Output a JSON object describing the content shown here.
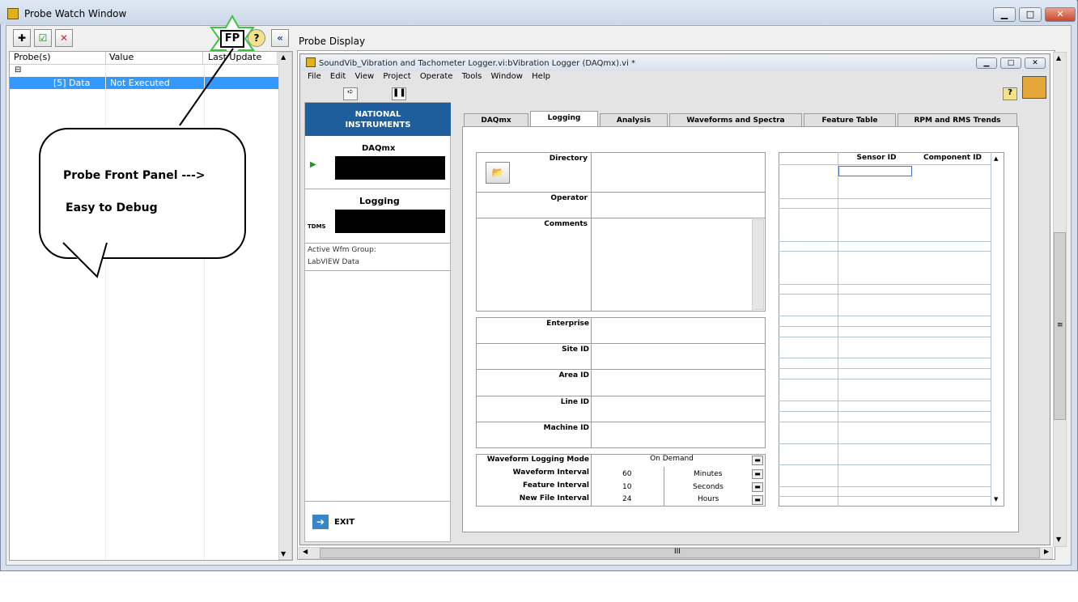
{
  "window": {
    "title": "Probe Watch Window",
    "min": "▁",
    "max": "□",
    "close": "✕"
  },
  "toolbar": {
    "new_probe": "✚",
    "manage": "☑",
    "delete": "✕",
    "fp": "FP",
    "help": "?",
    "collapse": "«"
  },
  "probe_list": {
    "headers": [
      "Probe(s)",
      "Value",
      "Last Update"
    ],
    "group_toggle": "⊟",
    "rows": [
      {
        "probe": "[5] Data",
        "value": "Not Executed"
      }
    ]
  },
  "display_label": "Probe Display",
  "vi": {
    "title": "SoundVib_Vibration and Tachometer Logger.vi:bVibration Logger (DAQmx).vi *",
    "menu": [
      "File",
      "Edit",
      "View",
      "Project",
      "Operate",
      "Tools",
      "Window",
      "Help"
    ],
    "left": {
      "logo": "NATIONAL\nINSTRUMENTS",
      "daqmx_label": "DAQmx",
      "logging_label": "Logging",
      "tdms": "TDMS",
      "group_label": "Active Wfm Group:",
      "group_value": "LabVIEW Data",
      "exit_label": "EXIT"
    },
    "tabs": [
      "DAQmx",
      "Logging",
      "Analysis",
      "Waveforms and Spectra",
      "Feature Table",
      "RPM and RMS Trends"
    ],
    "form": {
      "directory": "Directory",
      "operator": "Operator",
      "comments": "Comments",
      "enterprise": "Enterprise",
      "site": "Site ID",
      "area": "Area ID",
      "line": "Line ID",
      "machine": "Machine ID",
      "mode_label": "Waveform Logging Mode",
      "mode_value": "On Demand",
      "wf_interval_label": "Waveform Interval",
      "wf_interval_value": "60",
      "wf_interval_unit": "Minutes",
      "feat_interval_label": "Feature Interval",
      "feat_interval_value": "10",
      "feat_interval_unit": "Seconds",
      "file_interval_label": "New File Interval",
      "file_interval_value": "24",
      "file_interval_unit": "Hours"
    },
    "table": {
      "headers": [
        "Sensor ID",
        "Component ID"
      ]
    }
  },
  "callout": {
    "line1": "Probe Front Panel --->",
    "line2": "Easy to Debug"
  },
  "scroll": {
    "mid": "III",
    "vmid": "≡"
  }
}
